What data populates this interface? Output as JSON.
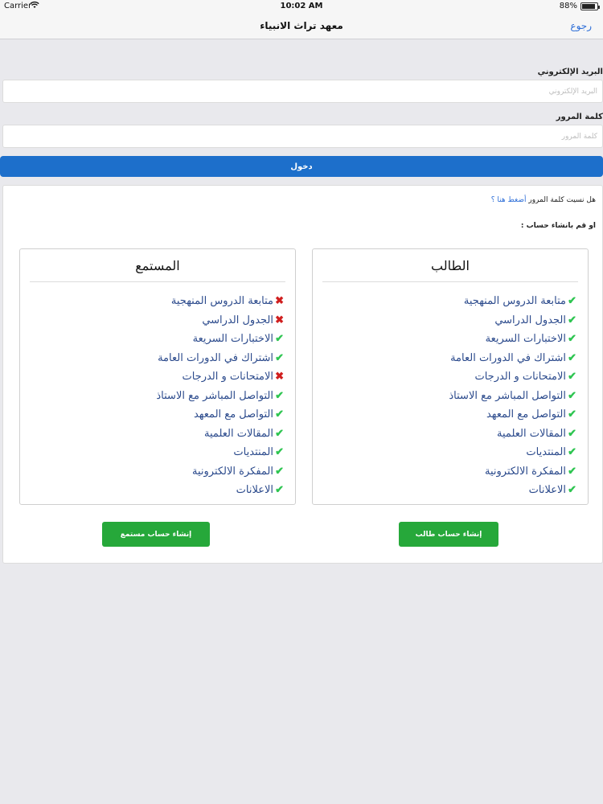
{
  "status_bar": {
    "carrier": "Carrier",
    "time": "10:02 AM",
    "battery": "88%",
    "battery_level": 0.88
  },
  "nav": {
    "title": "معهد تراث الانبياء",
    "back": "رجوع"
  },
  "login": {
    "email_label": "البريد الإلكتروني",
    "email_placeholder": "البريد الإلكتروني",
    "email_value": "",
    "password_label": "كلمة المرور",
    "password_placeholder": "كلمة المرور",
    "password_value": "",
    "submit": "دخول"
  },
  "panel": {
    "forgot_text": "هل نسيت كلمة المرور",
    "forgot_link": "أضغط هنا ؟",
    "or_create": "او قم بانشاء حساب :"
  },
  "accounts": {
    "student": {
      "title": "الطالب",
      "features": [
        {
          "text": "متابعة الدروس المنهجية",
          "included": true
        },
        {
          "text": "الجدول الدراسي",
          "included": true
        },
        {
          "text": "الاختبارات السريعة",
          "included": true
        },
        {
          "text": "اشتراك في الدورات العامة",
          "included": true
        },
        {
          "text": "الامتحانات و الدرجات",
          "included": true
        },
        {
          "text": "التواصل المباشر مع الاستاذ",
          "included": true
        },
        {
          "text": "التواصل مع المعهد",
          "included": true
        },
        {
          "text": "المقالات العلمية",
          "included": true
        },
        {
          "text": "المنتديات",
          "included": true
        },
        {
          "text": "المفكرة الالكترونية",
          "included": true
        },
        {
          "text": "الاعلانات",
          "included": true
        }
      ],
      "button": "إنشاء حساب طالب"
    },
    "listener": {
      "title": "المستمع",
      "features": [
        {
          "text": "متابعة الدروس المنهجية",
          "included": false
        },
        {
          "text": "الجدول الدراسي",
          "included": false
        },
        {
          "text": "الاختبارات السريعة",
          "included": true
        },
        {
          "text": "اشتراك في الدورات العامة",
          "included": true
        },
        {
          "text": "الامتحانات و الدرجات",
          "included": false
        },
        {
          "text": "التواصل المباشر مع الاستاذ",
          "included": true
        },
        {
          "text": "التواصل مع المعهد",
          "included": true
        },
        {
          "text": "المقالات العلمية",
          "included": true
        },
        {
          "text": "المنتديات",
          "included": true
        },
        {
          "text": "المفكرة الالكترونية",
          "included": true
        },
        {
          "text": "الاعلانات",
          "included": true
        }
      ],
      "button": "إنشاء حساب مستمع"
    }
  },
  "icons": {
    "included": "check-icon",
    "excluded": "cross-icon"
  },
  "colors": {
    "primary": "#1d6fcb",
    "success": "#26a83a",
    "check": "#2ec551",
    "cross": "#d01f1f",
    "feature_text": "#2b4a8c"
  }
}
